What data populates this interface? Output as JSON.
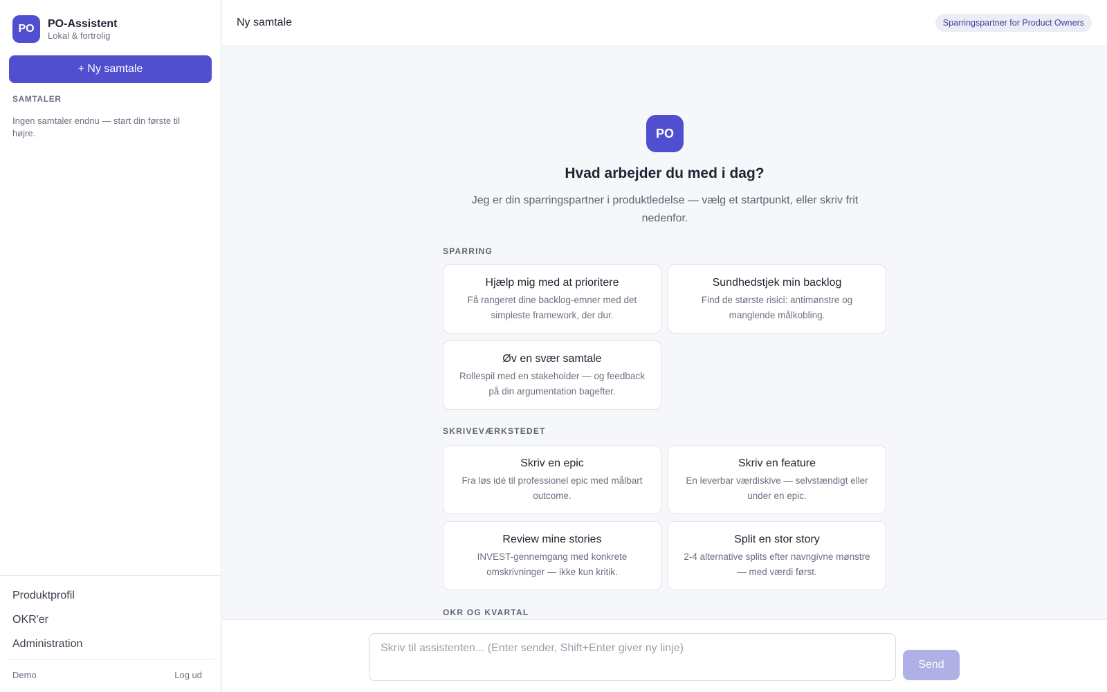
{
  "sidebar": {
    "brand": {
      "logo_text": "PO",
      "title": "PO-Assistent",
      "subtitle": "Lokal & fortrolig"
    },
    "new_chat_label": "+ Ny samtale",
    "section_label": "SAMTALER",
    "empty_note": "Ingen samtaler endnu — start din første til højre.",
    "links": [
      "Produktprofil",
      "OKR'er",
      "Administration"
    ],
    "user": "Demo",
    "logout_label": "Log ud"
  },
  "header": {
    "title": "Ny samtale",
    "badge": "Sparringspartner for Product Owners"
  },
  "hero": {
    "logo_text": "PO",
    "title": "Hvad arbejder du med i dag?",
    "subtitle": "Jeg er din sparringspartner i produktledelse — vælg et startpunkt, eller skriv frit nedenfor."
  },
  "groups": [
    {
      "label": "SPARRING",
      "cards": [
        {
          "title": "Hjælp mig med at prioritere",
          "desc": "Få rangeret dine backlog-emner med det simpleste framework, der dur."
        },
        {
          "title": "Sundhedstjek min backlog",
          "desc": "Find de største risici: antimønstre og manglende målkobling."
        },
        {
          "title": "Øv en svær samtale",
          "desc": "Rollespil med en stakeholder — og feedback på din argumentation bagefter."
        }
      ]
    },
    {
      "label": "SKRIVEVÆRKSTEDET",
      "cards": [
        {
          "title": "Skriv en epic",
          "desc": "Fra løs idé til professionel epic med målbart outcome."
        },
        {
          "title": "Skriv en feature",
          "desc": "En leverbar værdiskive — selvstændigt eller under en epic."
        },
        {
          "title": "Review mine stories",
          "desc": "INVEST-gennemgang med konkrete omskrivninger — ikke kun kritik."
        },
        {
          "title": "Split en stor story",
          "desc": "2-4 alternative splits efter navngivne mønstre — med værdi først."
        }
      ]
    },
    {
      "label": "OKR OG KVARTAL",
      "cards": []
    }
  ],
  "composer": {
    "placeholder": "Skriv til assistenten... (Enter sender, Shift+Enter giver ny linje)",
    "send_label": "Send"
  },
  "colors": {
    "accent": "#4f4fd0",
    "send_disabled": "#aeb0e6",
    "background": "#f6f7fa"
  }
}
